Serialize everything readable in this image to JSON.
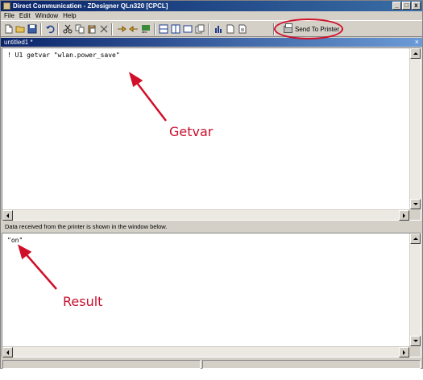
{
  "window": {
    "title": "Direct Communication - ZDesigner QLn320 [CPCL]",
    "controls": [
      "_",
      "□",
      "x"
    ]
  },
  "menubar": [
    "File",
    "Edit",
    "Window",
    "Help"
  ],
  "toolbar": {
    "send_label": "Send To Printer",
    "icons": [
      "new-file-icon",
      "open-folder-icon",
      "save-icon",
      "undo-icon",
      "cut-icon",
      "copy-icon",
      "paste-icon",
      "delete-icon",
      "send-arrow-icon",
      "receive-arrow-icon",
      "font-icon",
      "layout-h-icon",
      "layout-v-icon",
      "layout-single-icon",
      "layout-tabs-icon",
      "chart-icon",
      "document-icon",
      "document-open-icon"
    ]
  },
  "tab": {
    "label": "untitled1 *",
    "close": "×"
  },
  "command_pane": {
    "text": "! U1 getvar \"wlan.power_save\""
  },
  "info_text": "Data received from the printer is shown in the window below.",
  "result_pane": {
    "text": "\"on\""
  },
  "annotations": {
    "getvar_label": "Getvar",
    "result_label": "Result",
    "color": "#c8102e"
  }
}
